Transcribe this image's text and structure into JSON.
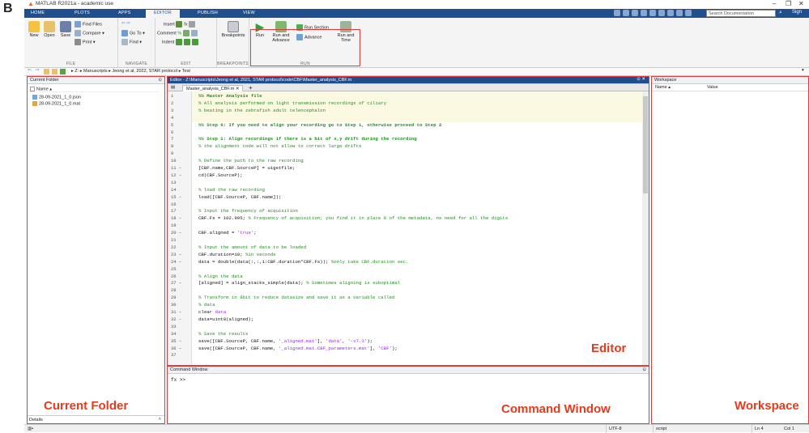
{
  "figure_label": "B",
  "window_title": "MATLAB R2021a - academic use",
  "window_controls": {
    "minimize": "–",
    "restore": "❐",
    "close": "✕"
  },
  "tabs": [
    "HOME",
    "PLOTS",
    "APPS",
    "EDITOR",
    "PUBLISH",
    "VIEW"
  ],
  "search_placeholder": "Search Documentation",
  "signin": "Sign",
  "toolstrip": {
    "file": {
      "label": "FILE",
      "new": "New",
      "open": "Open",
      "save": "Save",
      "find_files": "Find Files",
      "compare": "Compare ▾",
      "print": "Print ▾"
    },
    "navigate": {
      "label": "NAVIGATE",
      "goto": "Go To ▾",
      "find": "Find ▾"
    },
    "edit": {
      "label": "EDIT",
      "insert": "Insert",
      "comment": "Comment",
      "indent": "Indent"
    },
    "breakpoints": {
      "label": "BREAKPOINTS",
      "btn": "Breakpoints"
    },
    "run": {
      "label": "RUN",
      "run": "Run",
      "run_and_advance": "Run and Advance",
      "run_section": "Run Section",
      "advance": "Advance",
      "run_and_time": "Run and Time"
    }
  },
  "address_path": "▸ Z: ▸ Manuscripts ▸ Jeong et al, 2022, STAR protocol ▸ Test",
  "current_folder": {
    "title": "Current Folder",
    "column": "Name ▴",
    "files": [
      "28-09-2021_1_0.json",
      "28-09-2021_1_0.mat"
    ],
    "details": "Details",
    "overlay_label": "Current Folder"
  },
  "editor": {
    "title": "Editor - Z:\\Manuscripts\\Jeong et al, 2021, STAR protocol\\code\\CBF\\Master_analysis_CBF.m",
    "tab": "Master_analysis_CBF.m",
    "overlay_label": "Editor",
    "lines": [
      {
        "n": "1",
        "t": "%% Master Analysis file",
        "k": "c b"
      },
      {
        "n": "2",
        "t": "% All analysis performed on light transmission recordings of ciliary",
        "k": "c"
      },
      {
        "n": "3",
        "t": "% beating in the zebrafish adult telencephalon",
        "k": "c"
      },
      {
        "n": "4",
        "t": "",
        "k": ""
      },
      {
        "n": "5",
        "t": "%% Step 0: If you need to align your recording go to Step 1, otherwise proceed to Step 2",
        "k": "c b"
      },
      {
        "n": "6",
        "t": "",
        "k": ""
      },
      {
        "n": "7",
        "t": "%% Step 1: Align recordings if there is a bit of x,y drift during the recording",
        "k": "c b"
      },
      {
        "n": "8",
        "t": "% the alignment code will not allow to correct large drifts",
        "k": "c"
      },
      {
        "n": "9",
        "t": "",
        "k": ""
      },
      {
        "n": "10",
        "t": "% Define the path to the raw recording",
        "k": "c"
      },
      {
        "n": "11 –",
        "t": "[CBF.name,CBF.SourceP] = uigetfile;",
        "k": ""
      },
      {
        "n": "12 –",
        "t": "cd(CBF.SourceP);",
        "k": ""
      },
      {
        "n": "13",
        "t": "",
        "k": ""
      },
      {
        "n": "14",
        "t": "% load the raw recording",
        "k": "c"
      },
      {
        "n": "15 –",
        "t": "load([CBF.SourceP, CBF.name]);",
        "k": ""
      },
      {
        "n": "16",
        "t": "",
        "k": ""
      },
      {
        "n": "17",
        "t": "% Input the frequency of acquisition",
        "k": "c"
      },
      {
        "n": "18 –",
        "t": "CBF.Fs = 102.995; % Frequency of acquisition; you find it in place 8 of the metadata, no need for all the digits",
        "k": "mix1"
      },
      {
        "n": "19",
        "t": "",
        "k": ""
      },
      {
        "n": "20 –",
        "t": "CBF.aligned = 'true';",
        "k": "mix2"
      },
      {
        "n": "21",
        "t": "",
        "k": ""
      },
      {
        "n": "22",
        "t": "% Input the amount of data to be loaded",
        "k": "c"
      },
      {
        "n": "23 –",
        "t": "CBF.duration=10; %in seconds",
        "k": "mix3"
      },
      {
        "n": "24 –",
        "t": "data = double(data(:,:,1:CBF.duration*CBF.Fs)); %only take CBF.duration sec.",
        "k": "mix4"
      },
      {
        "n": "25",
        "t": "",
        "k": ""
      },
      {
        "n": "26",
        "t": "% Align the data",
        "k": "c"
      },
      {
        "n": "27 –",
        "t": "[aligned] = align_stacks_simple(data); % Sometimes aligning is suboptimal",
        "k": "mix5"
      },
      {
        "n": "28",
        "t": "",
        "k": ""
      },
      {
        "n": "29",
        "t": "% Transform in 8bit to reduce datasize and save it as a variable called",
        "k": "c"
      },
      {
        "n": "30",
        "t": "% data",
        "k": "c"
      },
      {
        "n": "31 –",
        "t": "clear data",
        "k": "mix6"
      },
      {
        "n": "32 –",
        "t": "data=uint8(aligned);",
        "k": ""
      },
      {
        "n": "33",
        "t": "",
        "k": ""
      },
      {
        "n": "34",
        "t": "% Save the results",
        "k": "c"
      },
      {
        "n": "35 –",
        "t": "save([CBF.SourceP, CBF.name, '_aligned.mat'], 'data', '-v7.3');",
        "k": "mix7"
      },
      {
        "n": "36 –",
        "t": "save([CBF.SourceP, CBF.name, '_aligned.mat.CBF_parameters.mat'], 'CBF');",
        "k": "mix8"
      },
      {
        "n": "37",
        "t": "",
        "k": ""
      }
    ]
  },
  "command_window": {
    "title": "Command Window",
    "prompt": "fx >>",
    "overlay_label": "Command Window"
  },
  "workspace": {
    "title": "Workspace",
    "col_name": "Name ▴",
    "col_value": "Value",
    "overlay_label": "Workspace"
  },
  "status": {
    "encoding": "UTF-8",
    "type": "script",
    "ln": "Ln  4",
    "col": "Col  1"
  },
  "colors": {
    "accent": "#1f4f8c",
    "highlight": "#e23a3a",
    "overlay_text": "#e83a1a",
    "comment": "#228b22",
    "string": "#a020f0"
  }
}
